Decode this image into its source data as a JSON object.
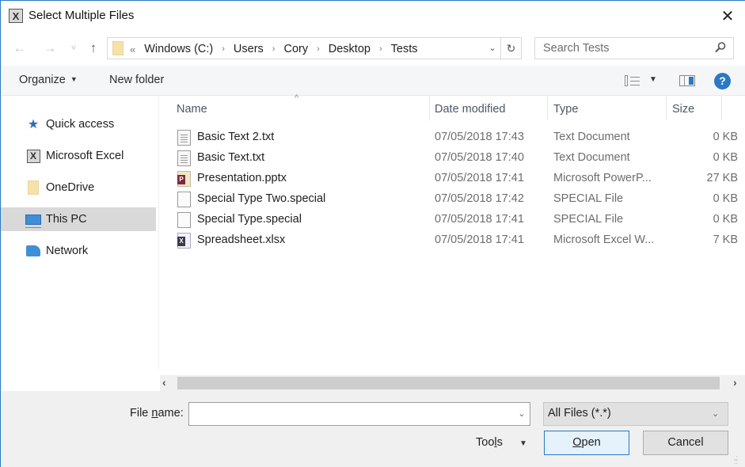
{
  "window": {
    "title": "Select Multiple Files",
    "app_icon": "excel-app-icon",
    "close_glyph": "✕"
  },
  "nav": {
    "back_glyph": "←",
    "forward_glyph": "→",
    "recent_glyph": "˅",
    "up_glyph": "↑",
    "overflow_glyph": "«",
    "breadcrumbs": [
      "Windows (C:)",
      "Users",
      "Cory",
      "Desktop",
      "Tests"
    ],
    "separator_glyph": "›",
    "refresh_glyph": "↻",
    "dropdown_glyph": "⌄"
  },
  "search": {
    "placeholder": "Search Tests",
    "value": ""
  },
  "toolbar": {
    "organize_label": "Organize",
    "new_folder_label": "New folder",
    "caret_glyph": "▼",
    "help_glyph": "?"
  },
  "sidebar": {
    "items": [
      {
        "label": "Quick access",
        "icon": "star-icon",
        "selected": false
      },
      {
        "label": "Microsoft Excel",
        "icon": "excel-icon",
        "selected": false
      },
      {
        "label": "OneDrive",
        "icon": "folder-icon",
        "selected": false
      },
      {
        "label": "This PC",
        "icon": "computer-icon",
        "selected": true
      },
      {
        "label": "Network",
        "icon": "network-icon",
        "selected": false
      }
    ]
  },
  "filelist": {
    "sort_glyph": "^",
    "columns": [
      "Name",
      "Date modified",
      "Type",
      "Size"
    ],
    "rows": [
      {
        "name": "Basic Text 2.txt",
        "date": "07/05/2018 17:43",
        "type": "Text Document",
        "size": "0 KB",
        "icon": "text-file-icon"
      },
      {
        "name": "Basic Text.txt",
        "date": "07/05/2018 17:40",
        "type": "Text Document",
        "size": "0 KB",
        "icon": "text-file-icon"
      },
      {
        "name": "Presentation.pptx",
        "date": "07/05/2018 17:41",
        "type": "Microsoft PowerP...",
        "size": "27 KB",
        "icon": "powerpoint-file-icon"
      },
      {
        "name": "Special Type Two.special",
        "date": "07/05/2018 17:42",
        "type": "SPECIAL File",
        "size": "0 KB",
        "icon": "blank-file-icon"
      },
      {
        "name": "Special Type.special",
        "date": "07/05/2018 17:41",
        "type": "SPECIAL File",
        "size": "0 KB",
        "icon": "blank-file-icon"
      },
      {
        "name": "Spreadsheet.xlsx",
        "date": "07/05/2018 17:41",
        "type": "Microsoft Excel W...",
        "size": "7 KB",
        "icon": "excel-file-icon"
      }
    ]
  },
  "scrollbar": {
    "left_glyph": "‹",
    "right_glyph": "›"
  },
  "bottom": {
    "file_name_label_pre": "File ",
    "file_name_label_accel": "n",
    "file_name_label_post": "ame:",
    "file_name_value": "",
    "filter_value": "All Files (*.*)",
    "tools_pre": "Too",
    "tools_accel": "l",
    "tools_post": "s",
    "open_accel": "O",
    "open_rest": "pen",
    "cancel_label": "Cancel"
  }
}
